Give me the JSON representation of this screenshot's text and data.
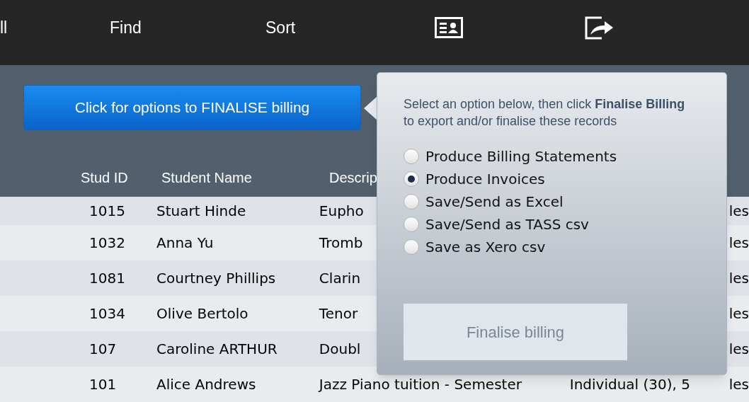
{
  "toolbar": {
    "items": [
      {
        "kind": "text",
        "label": "ll"
      },
      {
        "kind": "text",
        "label": "Find"
      },
      {
        "kind": "text",
        "label": "Sort"
      },
      {
        "kind": "card"
      },
      {
        "kind": "share"
      }
    ]
  },
  "finalise_button": {
    "label": "Click for options to FINALISE billing"
  },
  "table": {
    "columns": [
      "Stud ID",
      "Student Name",
      "Descrip"
    ],
    "rows": [
      {
        "id": "1015",
        "name": "Stuart Hinde",
        "description": "Eupho",
        "column_5": "les"
      },
      {
        "id": "1032",
        "name": "Anna Yu",
        "description": "Tromb",
        "column_5": "les"
      },
      {
        "id": "1081",
        "name": "Courtney Phillips",
        "description": "Clarin",
        "column_5": "les"
      },
      {
        "id": "1034",
        "name": "Olive Bertolo",
        "description": "Tenor",
        "column_5": "les"
      },
      {
        "id": "107",
        "name": "Caroline ARTHUR",
        "description": "Doubl",
        "column_5": "les"
      },
      {
        "id": "101",
        "name": "Alice Andrews",
        "description": "Jazz Piano tuition - Semester",
        "column_4": "Individual (30), 5",
        "column_5": "les"
      }
    ]
  },
  "popover": {
    "instructions": "Select an option below, then click **Finalise Billing** to export and/or finalise these records",
    "options": [
      {
        "label": "Produce Billing Statements",
        "selected": false
      },
      {
        "label": "Produce Invoices",
        "selected": true
      },
      {
        "label": "Save/Send as Excel",
        "selected": false
      },
      {
        "label": "Save/Send as TASS csv",
        "selected": false
      },
      {
        "label": "Save as Xero csv",
        "selected": false
      }
    ],
    "button": {
      "label": "Finalise billing",
      "disabled": true
    }
  }
}
